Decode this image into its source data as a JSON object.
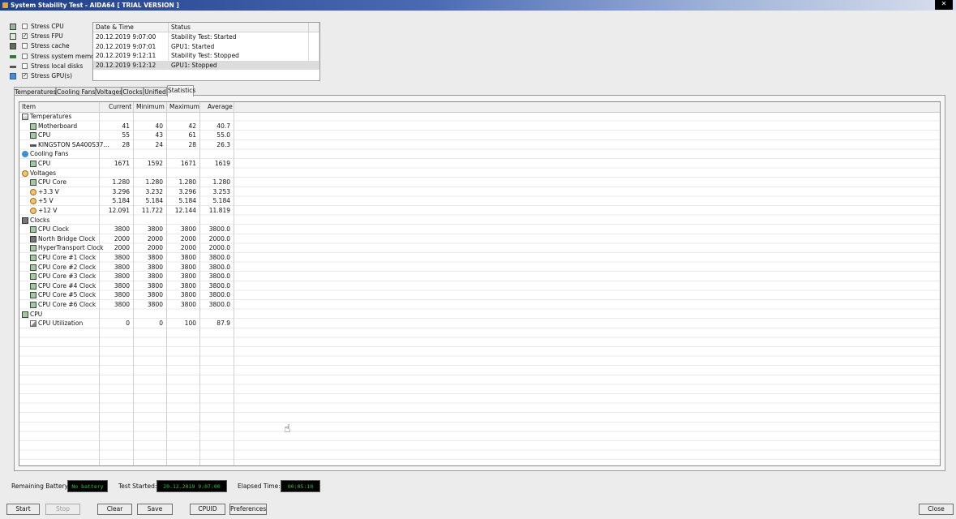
{
  "window": {
    "title": "System Stability Test - AIDA64  [ TRIAL VERSION ]"
  },
  "stress_options": [
    {
      "label": "Stress CPU",
      "checked": false,
      "icon": "cpu-chip-icon"
    },
    {
      "label": "Stress FPU",
      "checked": true,
      "icon": "fpu-chip-icon"
    },
    {
      "label": "Stress cache",
      "checked": false,
      "icon": "cache-icon"
    },
    {
      "label": "Stress system memory",
      "checked": false,
      "icon": "memory-icon"
    },
    {
      "label": "Stress local disks",
      "checked": false,
      "icon": "disk-icon"
    },
    {
      "label": "Stress GPU(s)",
      "checked": true,
      "icon": "gpu-icon"
    }
  ],
  "log": {
    "columns": [
      "Date & Time",
      "Status"
    ],
    "rows": [
      {
        "datetime": "20.12.2019 9:07:00",
        "status": "Stability Test: Started"
      },
      {
        "datetime": "20.12.2019 9:07:01",
        "status": "GPU1: Started"
      },
      {
        "datetime": "20.12.2019 9:12:11",
        "status": "Stability Test: Stopped"
      },
      {
        "datetime": "20.12.2019 9:12:12",
        "status": "GPU1: Stopped"
      }
    ]
  },
  "tabs": [
    "Temperatures",
    "Cooling Fans",
    "Voltages",
    "Clocks",
    "Unified",
    "Statistics"
  ],
  "active_tab": "Statistics",
  "stats": {
    "columns": {
      "item": "Item",
      "current": "Current",
      "minimum": "Minimum",
      "maximum": "Maximum",
      "average": "Average"
    },
    "rows": [
      {
        "type": "group",
        "label": "Temperatures",
        "icon": "thermometer-icon"
      },
      {
        "type": "item",
        "label": "Motherboard",
        "icon": "motherboard-icon",
        "current": "41",
        "minimum": "40",
        "maximum": "42",
        "average": "40.7"
      },
      {
        "type": "item",
        "label": "CPU",
        "icon": "cpu-icon",
        "current": "55",
        "minimum": "43",
        "maximum": "61",
        "average": "55.0"
      },
      {
        "type": "item",
        "label": "KINGSTON SA400S37...",
        "icon": "drive-icon",
        "current": "28",
        "minimum": "24",
        "maximum": "28",
        "average": "26.3"
      },
      {
        "type": "group",
        "label": "Cooling Fans",
        "icon": "fan-icon"
      },
      {
        "type": "item",
        "label": "CPU",
        "icon": "cpu-icon",
        "current": "1671",
        "minimum": "1592",
        "maximum": "1671",
        "average": "1619"
      },
      {
        "type": "group",
        "label": "Voltages",
        "icon": "voltage-icon"
      },
      {
        "type": "item",
        "label": "CPU Core",
        "icon": "cpu-icon",
        "current": "1.280",
        "minimum": "1.280",
        "maximum": "1.280",
        "average": "1.280"
      },
      {
        "type": "item",
        "label": "+3.3 V",
        "icon": "voltage-icon",
        "current": "3.296",
        "minimum": "3.232",
        "maximum": "3.296",
        "average": "3.253"
      },
      {
        "type": "item",
        "label": "+5 V",
        "icon": "voltage-icon",
        "current": "5.184",
        "minimum": "5.184",
        "maximum": "5.184",
        "average": "5.184"
      },
      {
        "type": "item",
        "label": "+12 V",
        "icon": "voltage-icon",
        "current": "12.091",
        "minimum": "11.722",
        "maximum": "12.144",
        "average": "11.819"
      },
      {
        "type": "group",
        "label": "Clocks",
        "icon": "clock-icon"
      },
      {
        "type": "item",
        "label": "CPU Clock",
        "icon": "cpu-icon",
        "current": "3800",
        "minimum": "3800",
        "maximum": "3800",
        "average": "3800.0"
      },
      {
        "type": "item",
        "label": "North Bridge Clock",
        "icon": "northbridge-icon",
        "current": "2000",
        "minimum": "2000",
        "maximum": "2000",
        "average": "2000.0"
      },
      {
        "type": "item",
        "label": "HyperTransport Clock",
        "icon": "cpu-icon",
        "current": "2000",
        "minimum": "2000",
        "maximum": "2000",
        "average": "2000.0"
      },
      {
        "type": "item",
        "label": "CPU Core #1 Clock",
        "icon": "cpu-icon",
        "current": "3800",
        "minimum": "3800",
        "maximum": "3800",
        "average": "3800.0"
      },
      {
        "type": "item",
        "label": "CPU Core #2 Clock",
        "icon": "cpu-icon",
        "current": "3800",
        "minimum": "3800",
        "maximum": "3800",
        "average": "3800.0"
      },
      {
        "type": "item",
        "label": "CPU Core #3 Clock",
        "icon": "cpu-icon",
        "current": "3800",
        "minimum": "3800",
        "maximum": "3800",
        "average": "3800.0"
      },
      {
        "type": "item",
        "label": "CPU Core #4 Clock",
        "icon": "cpu-icon",
        "current": "3800",
        "minimum": "3800",
        "maximum": "3800",
        "average": "3800.0"
      },
      {
        "type": "item",
        "label": "CPU Core #5 Clock",
        "icon": "cpu-icon",
        "current": "3800",
        "minimum": "3800",
        "maximum": "3800",
        "average": "3800.0"
      },
      {
        "type": "item",
        "label": "CPU Core #6 Clock",
        "icon": "cpu-icon",
        "current": "3800",
        "minimum": "3800",
        "maximum": "3800",
        "average": "3800.0"
      },
      {
        "type": "group",
        "label": "CPU",
        "icon": "cpu-icon"
      },
      {
        "type": "item",
        "label": "CPU Utilization",
        "icon": "hourglass-icon",
        "current": "0",
        "minimum": "0",
        "maximum": "100",
        "average": "87.9"
      }
    ]
  },
  "status": {
    "battery_label": "Remaining Battery:",
    "battery_value": "No battery",
    "started_label": "Test Started:",
    "started_value": "20.12.2019 9:07:00",
    "elapsed_label": "Elapsed Time:",
    "elapsed_value": "00:05:10",
    "value_color": "#27c93f"
  },
  "buttons": {
    "start": "Start",
    "stop": "Stop",
    "clear": "Clear",
    "save": "Save",
    "cpuid": "CPUID",
    "preferences": "Preferences",
    "close": "Close"
  }
}
